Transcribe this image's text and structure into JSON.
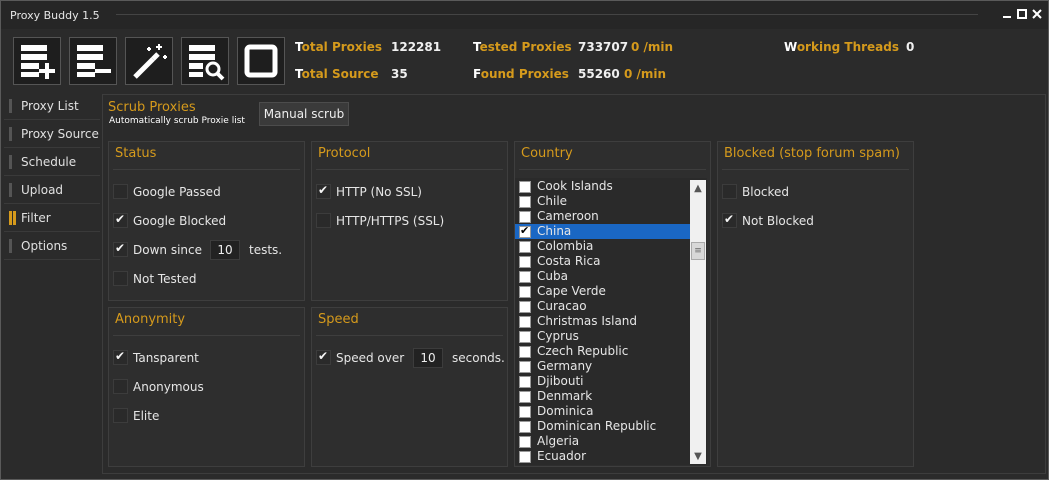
{
  "window": {
    "title": "Proxy Buddy 1.5"
  },
  "toolbar": {
    "buttons": [
      {
        "name": "add-list-button",
        "icon": "list-add-icon"
      },
      {
        "name": "remove-list-button",
        "icon": "list-remove-icon"
      },
      {
        "name": "magic-wand-button",
        "icon": "magic-wand-icon"
      },
      {
        "name": "search-list-button",
        "icon": "list-search-icon"
      },
      {
        "name": "stop-button",
        "icon": "stop-icon"
      }
    ]
  },
  "stats": {
    "total_proxies": {
      "first": "T",
      "rest": "otal Proxies",
      "value": "122281"
    },
    "total_source": {
      "first": "T",
      "rest": "otal Source",
      "value": "35"
    },
    "tested_proxies": {
      "first": "T",
      "rest": "ested Proxies",
      "value": "733707",
      "rate": "0 /min"
    },
    "found_proxies": {
      "first": "F",
      "rest": "ound Proxies",
      "value": "55260",
      "rate": "0 /min"
    },
    "working_threads": {
      "first": "W",
      "rest": "orking Threads",
      "value": "0"
    }
  },
  "sidebar": {
    "items": [
      {
        "label": "Proxy List"
      },
      {
        "label": "Proxy Source"
      },
      {
        "label": "Schedule"
      },
      {
        "label": "Upload"
      },
      {
        "label": "Filter"
      },
      {
        "label": "Options"
      }
    ],
    "active_index": 4
  },
  "scrub": {
    "title": "Scrub Proxies",
    "subtitle": "Automatically scrub Proxie list",
    "manual_button": "Manual scrub"
  },
  "status_panel": {
    "title": "Status",
    "google_passed": "Google Passed",
    "google_blocked": "Google Blocked",
    "down_since": "Down since",
    "down_since_value": "10",
    "tests": "tests.",
    "not_tested": "Not Tested"
  },
  "protocol_panel": {
    "title": "Protocol",
    "http": "HTTP (No SSL)",
    "https": "HTTP/HTTPS (SSL)"
  },
  "anonymity_panel": {
    "title": "Anonymity",
    "transparent": "Tansparent",
    "anonymous": "Anonymous",
    "elite": "Elite"
  },
  "speed_panel": {
    "title": "Speed",
    "speed_over": "Speed over",
    "value": "10",
    "seconds": "seconds."
  },
  "country_panel": {
    "title": "Country",
    "items": [
      {
        "name": "Cook Islands",
        "checked": false
      },
      {
        "name": "Chile",
        "checked": false
      },
      {
        "name": "Cameroon",
        "checked": false
      },
      {
        "name": "China",
        "checked": true,
        "selected": true
      },
      {
        "name": "Colombia",
        "checked": false
      },
      {
        "name": "Costa Rica",
        "checked": false
      },
      {
        "name": "Cuba",
        "checked": false
      },
      {
        "name": "Cape Verde",
        "checked": false
      },
      {
        "name": "Curacao",
        "checked": false
      },
      {
        "name": "Christmas Island",
        "checked": false
      },
      {
        "name": "Cyprus",
        "checked": false
      },
      {
        "name": "Czech Republic",
        "checked": false
      },
      {
        "name": "Germany",
        "checked": false
      },
      {
        "name": "Djibouti",
        "checked": false
      },
      {
        "name": "Denmark",
        "checked": false
      },
      {
        "name": "Dominica",
        "checked": false
      },
      {
        "name": "Dominican Republic",
        "checked": false
      },
      {
        "name": "Algeria",
        "checked": false
      },
      {
        "name": "Ecuador",
        "checked": false
      }
    ]
  },
  "blocked_panel": {
    "title": "Blocked (stop forum spam)",
    "blocked": "Blocked",
    "not_blocked": "Not Blocked"
  },
  "colors": {
    "accent": "#d59a1c",
    "selection": "#1a67c4",
    "background": "#2b2b2b"
  }
}
